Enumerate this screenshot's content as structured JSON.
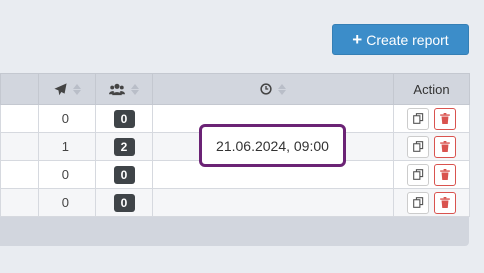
{
  "toolbar": {
    "create_label": "Create report"
  },
  "table": {
    "header": {
      "action": "Action"
    },
    "rows": [
      {
        "col_a": "",
        "sent": "0",
        "users": "0",
        "alt": false
      },
      {
        "col_a": "",
        "sent": "1",
        "users": "2",
        "alt": true
      },
      {
        "col_a": "",
        "sent": "0",
        "users": "0",
        "alt": false
      },
      {
        "col_a": "",
        "sent": "0",
        "users": "0",
        "alt": true
      }
    ]
  },
  "tooltip": {
    "text": "21.06.2024, 09:00"
  },
  "icons": {
    "send": "paper-plane-icon",
    "users": "users-icon",
    "time": "clock-icon",
    "copy": "copy-icon",
    "delete": "trash-icon"
  },
  "colors": {
    "primary": "#3c8dc9",
    "danger": "#d9534f",
    "badge": "#3f4448",
    "tooltip_border": "#6b2375"
  }
}
